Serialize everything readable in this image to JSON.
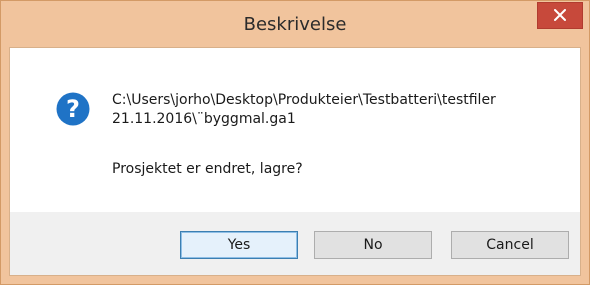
{
  "window": {
    "title": "Beskrivelse"
  },
  "icons": {
    "close": "close-icon",
    "question": "question-icon"
  },
  "message": {
    "path_line1": "C:\\Users\\jorho\\Desktop\\Produkteier\\Testbatteri\\testfiler",
    "path_line2": "21.11.2016\\¨byggmal.ga1",
    "prompt": "Prosjektet er endret, lagre?"
  },
  "buttons": {
    "yes": "Yes",
    "no": "No",
    "cancel": "Cancel"
  },
  "colors": {
    "titlebar": "#f1c49d",
    "close_button": "#c7493b",
    "question_icon": "#1f73c6",
    "footer": "#f0f0f0"
  }
}
